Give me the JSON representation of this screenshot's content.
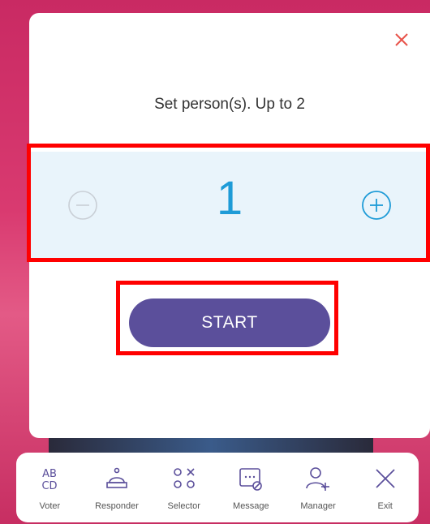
{
  "dialog": {
    "title": "Set person(s). Up to 2",
    "count": "1",
    "start_label": "START"
  },
  "toolbar": {
    "items": [
      {
        "label": "Voter",
        "icon": "abcd-icon"
      },
      {
        "label": "Responder",
        "icon": "bell-icon"
      },
      {
        "label": "Selector",
        "icon": "selector-icon"
      },
      {
        "label": "Message",
        "icon": "message-icon"
      },
      {
        "label": "Manager",
        "icon": "add-user-icon"
      },
      {
        "label": "Exit",
        "icon": "close-icon"
      }
    ]
  },
  "colors": {
    "background": "#d2366a",
    "accent": "#1e9bd7",
    "start_button": "#5b4f9b",
    "close": "#e8534a",
    "stepper_bg": "#e9f4fb",
    "highlight": "#ff0000"
  }
}
